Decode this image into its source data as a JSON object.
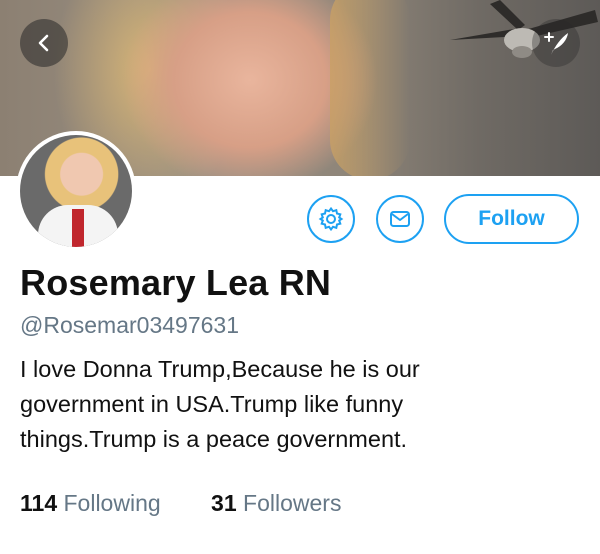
{
  "profile": {
    "name": "Rosemary Lea RN",
    "handle": "@Rosemar03497631",
    "bio_lines": [
      "I love Donna Trump,Because he is our",
      "government in USA.Trump like funny",
      "things.Trump is a peace government."
    ]
  },
  "actions": {
    "follow_label": "Follow"
  },
  "stats": {
    "following_count": "114",
    "following_label": "Following",
    "followers_count": "31",
    "followers_label": "Followers"
  },
  "icons": {
    "back": "chevron-left-icon",
    "compose": "compose-tweet-icon",
    "settings": "gear-icon",
    "message": "envelope-icon"
  },
  "colors": {
    "accent": "#1da1f2",
    "secondary_text": "#657786",
    "primary_text": "#111111"
  }
}
